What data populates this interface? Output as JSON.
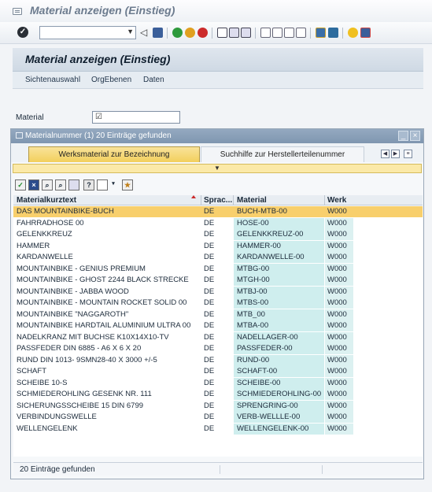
{
  "window": {
    "title": "Material anzeigen (Einstieg)"
  },
  "screen": {
    "title": "Material anzeigen (Einstieg)"
  },
  "menu": [
    "Sichtenauswahl",
    "OrgEbenen",
    "Daten"
  ],
  "field": {
    "label": "Material",
    "value": ""
  },
  "popup": {
    "title": "Materialnummer (1)  20 Einträge gefunden",
    "tabs": [
      {
        "label": "Werksmaterial zur Bezeichnung",
        "active": true
      },
      {
        "label": "Suchhilfe zur Herstellerteilenummer",
        "active": false
      }
    ],
    "columns": [
      "Materialkurztext",
      "Sprac...",
      "Material",
      "Werk"
    ],
    "rows": [
      [
        "DAS MOUNTAINBIKE-BUCH",
        "DE",
        "BUCH-MTB-00",
        "W000"
      ],
      [
        "FAHRRADHOSE 00",
        "DE",
        "HOSE-00",
        "W000"
      ],
      [
        "GELENKKREUZ",
        "DE",
        "GELENKKREUZ-00",
        "W000"
      ],
      [
        "HAMMER",
        "DE",
        "HAMMER-00",
        "W000"
      ],
      [
        "KARDANWELLE",
        "DE",
        "KARDANWELLE-00",
        "W000"
      ],
      [
        "MOUNTAINBIKE - GENIUS PREMIUM",
        "DE",
        "MTBG-00",
        "W000"
      ],
      [
        "MOUNTAINBIKE - GHOST 2244 BLACK STRECKE",
        "DE",
        "MTGH-00",
        "W000"
      ],
      [
        "MOUNTAINBIKE - JABBA WOOD",
        "DE",
        "MTBJ-00",
        "W000"
      ],
      [
        "MOUNTAINBIKE - MOUNTAIN ROCKET SOLID 00",
        "DE",
        "MTBS-00",
        "W000"
      ],
      [
        "MOUNTAINBIKE \"NAGGAROTH\"",
        "DE",
        "MTB_00",
        "W000"
      ],
      [
        "MOUNTAINBIKE HARDTAIL ALUMINIUM ULTRA 00",
        "DE",
        "MTBA-00",
        "W000"
      ],
      [
        "NADELKRANZ MIT BUCHSE K10X14X10-TV",
        "DE",
        "NADELLAGER-00",
        "W000"
      ],
      [
        "PASSFEDER DIN 6885 - A6 X 6 X 20",
        "DE",
        "PASSFEDER-00",
        "W000"
      ],
      [
        "RUND  DIN 1013- 9SMN28-40 X 3000 +/-5",
        "DE",
        "RUND-00",
        "W000"
      ],
      [
        "SCHAFT",
        "DE",
        "SCHAFT-00",
        "W000"
      ],
      [
        "SCHEIBE 10-S",
        "DE",
        "SCHEIBE-00",
        "W000"
      ],
      [
        "SCHMIEDEROHLING  GESENK NR. 111",
        "DE",
        "SCHMIEDEROHLING-00",
        "W000"
      ],
      [
        "SICHERUNGSSCHEIBE 15 DIN 6799",
        "DE",
        "SPRENGRING-00",
        "W000"
      ],
      [
        "VERBINDUNGSWELLE",
        "DE",
        "VERB-WELLLE-00",
        "W000"
      ],
      [
        "WELLENGELENK",
        "DE",
        "WELLENGELENK-00",
        "W000"
      ]
    ],
    "status": "20 Einträge gefunden"
  },
  "icons": [
    "check-icon",
    "save-icon",
    "back-icon",
    "exit-icon",
    "cancel-icon",
    "print-icon",
    "find-icon",
    "find-next-icon",
    "first-page-icon",
    "prev-page-icon",
    "next-page-icon",
    "last-page-icon",
    "new-session-icon",
    "shortcut-icon",
    "help-icon",
    "layout-icon"
  ],
  "colors": {
    "selected_row": "#f8cf6c",
    "material_col": "#cfeeee",
    "popup_title": "#8399b2",
    "active_tab": "#f2cf5c"
  }
}
